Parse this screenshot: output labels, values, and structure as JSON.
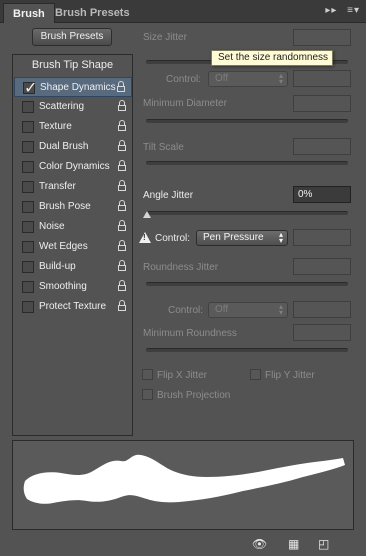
{
  "tabs": [
    {
      "label": "Brush"
    },
    {
      "label": "Brush Presets"
    }
  ],
  "tab_icons": [
    "collapse-arrows-icon",
    "panel-menu-icon"
  ],
  "left": {
    "presets_button": "Brush Presets",
    "tip_shape": "Brush Tip Shape",
    "items": [
      {
        "label": "Shape Dynamics",
        "checked": true,
        "selected": true
      },
      {
        "label": "Scattering",
        "checked": false
      },
      {
        "label": "Texture",
        "checked": false
      },
      {
        "label": "Dual Brush",
        "checked": false
      },
      {
        "label": "Color Dynamics",
        "checked": false
      },
      {
        "label": "Transfer",
        "checked": false
      },
      {
        "label": "Brush Pose",
        "checked": false
      },
      {
        "label": "Noise",
        "checked": false
      },
      {
        "label": "Wet Edges",
        "checked": false
      },
      {
        "label": "Build-up",
        "checked": false
      },
      {
        "label": "Smoothing",
        "checked": false
      },
      {
        "label": "Protect Texture",
        "checked": false
      }
    ]
  },
  "right": {
    "size_jitter": "Size Jitter",
    "tooltip": "Set the size randomness",
    "control_1": {
      "label": "Control:",
      "value": "Off"
    },
    "min_diameter": "Minimum Diameter",
    "tilt_scale": "Tilt Scale",
    "angle_jitter": {
      "label": "Angle Jitter",
      "value": "0%"
    },
    "control_2": {
      "label": "Control:",
      "value": "Pen Pressure",
      "warning": "!"
    },
    "roundness_jitter": "Roundness Jitter",
    "control_3": {
      "label": "Control:",
      "value": "Off"
    },
    "min_roundness": "Minimum Roundness",
    "flip_x": "Flip X Jitter",
    "flip_y": "Flip Y Jitter",
    "projection": "Brush Projection"
  },
  "bottom_icons": [
    "eye-toggle-icon",
    "grid-icon",
    "new-preset-icon"
  ],
  "colors": {
    "panel": "#535353",
    "selected": "#586a7d",
    "tooltip": "#fffbd6"
  }
}
